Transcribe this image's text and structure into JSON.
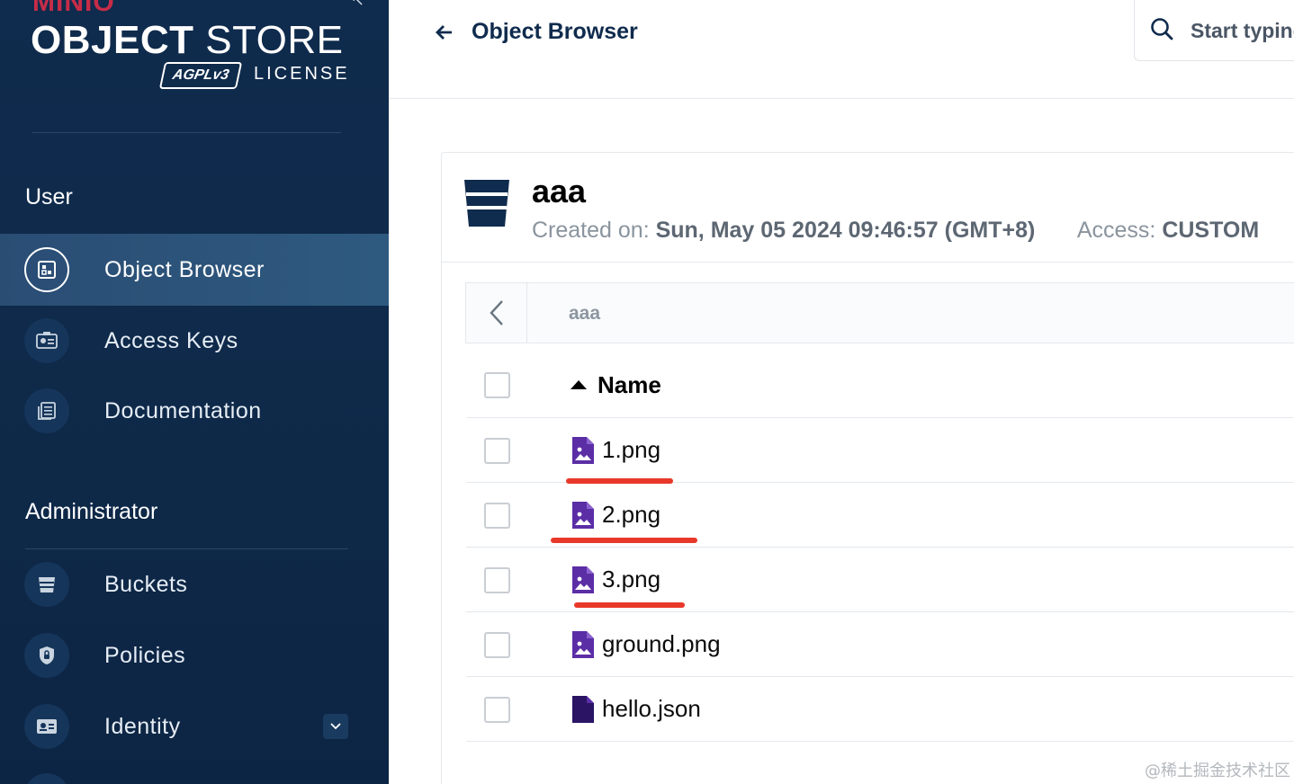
{
  "brand": {
    "logo": "MINIO",
    "title_bold": "OBJECT",
    "title_light": "STORE",
    "license_badge": "AGPLv3",
    "license_label": "LICENSE"
  },
  "sidebar": {
    "user_section": "User",
    "admin_section": "Administrator",
    "user_items": [
      {
        "label": "Object Browser",
        "icon": "object-browser-icon",
        "active": true
      },
      {
        "label": "Access Keys",
        "icon": "access-keys-icon",
        "active": false
      },
      {
        "label": "Documentation",
        "icon": "documentation-icon",
        "active": false
      }
    ],
    "admin_items": [
      {
        "label": "Buckets",
        "icon": "bucket-icon"
      },
      {
        "label": "Policies",
        "icon": "policy-shield-icon"
      },
      {
        "label": "Identity",
        "icon": "identity-card-icon",
        "expandable": true
      }
    ]
  },
  "header": {
    "title": "Object Browser",
    "search_placeholder": "Start typing"
  },
  "bucket": {
    "name": "aaa",
    "created_label": "Created on:",
    "created_value": "Sun, May 05 2024 09:46:57 (GMT+8)",
    "access_label": "Access:",
    "access_value": "CUSTOM"
  },
  "breadcrumb": {
    "path": "aaa"
  },
  "table": {
    "name_header": "Name",
    "sort": "ascending",
    "files": [
      {
        "name": "1.png",
        "type": "image",
        "highlighted": true
      },
      {
        "name": "2.png",
        "type": "image",
        "highlighted": true
      },
      {
        "name": "3.png",
        "type": "image",
        "highlighted": true
      },
      {
        "name": "ground.png",
        "type": "image",
        "highlighted": false
      },
      {
        "name": "hello.json",
        "type": "file",
        "highlighted": false
      }
    ]
  },
  "colors": {
    "sidebar_bg": "#0f2b4d",
    "active_item": "#2f5a80",
    "file_icon": "#5b2ea6",
    "highlight": "#e8382a"
  },
  "watermark": "@稀土掘金技术社区"
}
